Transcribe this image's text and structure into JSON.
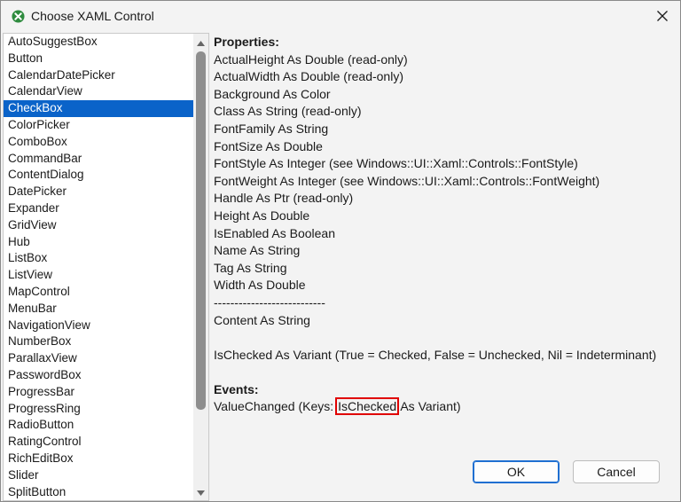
{
  "window": {
    "title": "Choose XAML Control",
    "accent": "#0a63c9"
  },
  "control_list": {
    "items": [
      "AutoSuggestBox",
      "Button",
      "CalendarDatePicker",
      "CalendarView",
      "CheckBox",
      "ColorPicker",
      "ComboBox",
      "CommandBar",
      "ContentDialog",
      "DatePicker",
      "Expander",
      "GridView",
      "Hub",
      "ListBox",
      "ListView",
      "MapControl",
      "MenuBar",
      "NavigationView",
      "NumberBox",
      "ParallaxView",
      "PasswordBox",
      "ProgressBar",
      "ProgressRing",
      "RadioButton",
      "RatingControl",
      "RichEditBox",
      "Slider",
      "SplitButton"
    ],
    "selected": "CheckBox"
  },
  "details": {
    "properties_heading": "Properties:",
    "properties": [
      "ActualHeight As Double (read-only)",
      "ActualWidth As Double (read-only)",
      "Background As Color",
      "Class As String (read-only)",
      "FontFamily As String",
      "FontSize As Double",
      "FontStyle As Integer (see Windows::UI::Xaml::Controls::FontStyle)",
      "FontWeight As Integer (see Windows::UI::Xaml::Controls::FontWeight)",
      "Handle As Ptr (read-only)",
      "Height As Double",
      "IsEnabled As Boolean",
      "Name As String",
      "Tag As String",
      "Width As Double"
    ],
    "separator": "---------------------------",
    "content_property": "Content As String",
    "checked_property": "IsChecked As Variant (True = Checked, False = Unchecked, Nil = Indeterminant)",
    "events_heading": "Events:",
    "event_prefix": "ValueChanged (Keys: ",
    "event_key": "IsChecked",
    "event_suffix": " As Variant)"
  },
  "buttons": {
    "ok": "OK",
    "cancel": "Cancel"
  }
}
